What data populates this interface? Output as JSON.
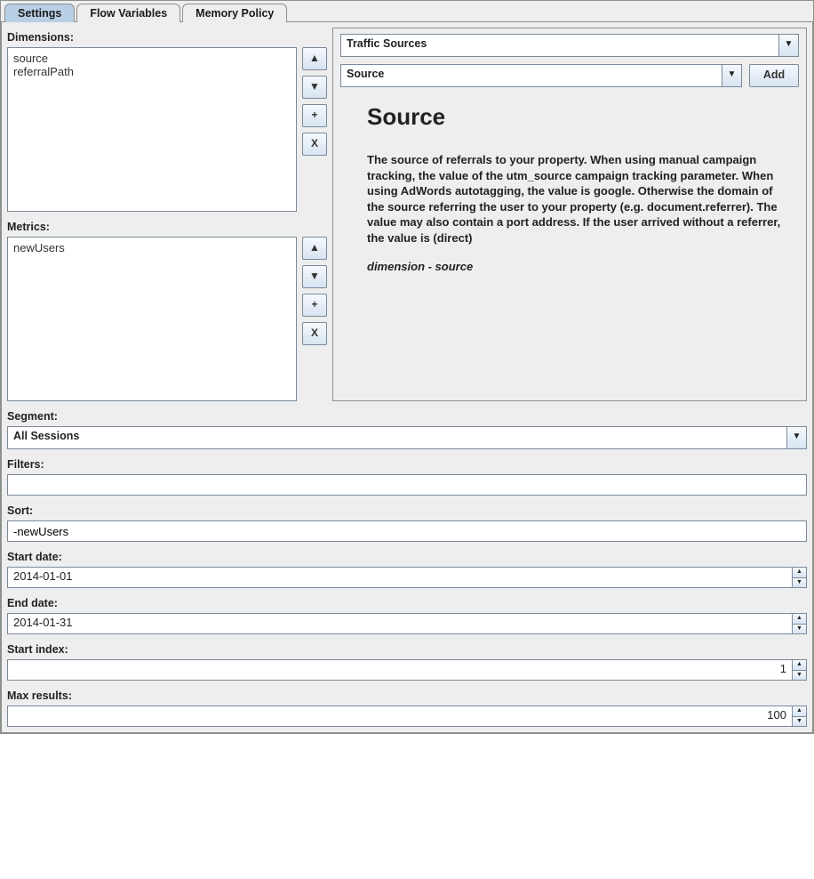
{
  "tabs": [
    "Settings",
    "Flow Variables",
    "Memory Policy"
  ],
  "active_tab": "Settings",
  "dimensions": {
    "label": "Dimensions:",
    "items": [
      "source",
      "referralPath"
    ]
  },
  "metrics": {
    "label": "Metrics:",
    "items": [
      "newUsers"
    ]
  },
  "list_buttons": {
    "move_up": "▲",
    "move_down": "▼",
    "add_item": "+",
    "remove_item": "X"
  },
  "picker": {
    "category": "Traffic Sources",
    "item": "Source",
    "add_label": "Add"
  },
  "detail": {
    "title": "Source",
    "description": "The source of referrals to your property. When using manual campaign tracking, the value of the utm_source campaign tracking parameter. When using AdWords autotagging, the value is google. Otherwise the domain of the source referring the user to your property (e.g. document.referrer). The value may also contain a port address. If the user arrived without a referrer, the value is (direct)",
    "meta": "dimension - source"
  },
  "segment": {
    "label": "Segment:",
    "value": "All Sessions"
  },
  "filters": {
    "label": "Filters:",
    "value": ""
  },
  "sort": {
    "label": "Sort:",
    "value": "-newUsers"
  },
  "start_date": {
    "label": "Start date:",
    "value": "2014-01-01"
  },
  "end_date": {
    "label": "End date:",
    "value": "2014-01-31"
  },
  "start_index": {
    "label": "Start index:",
    "value": "1"
  },
  "max_results": {
    "label": "Max results:",
    "value": "100"
  }
}
